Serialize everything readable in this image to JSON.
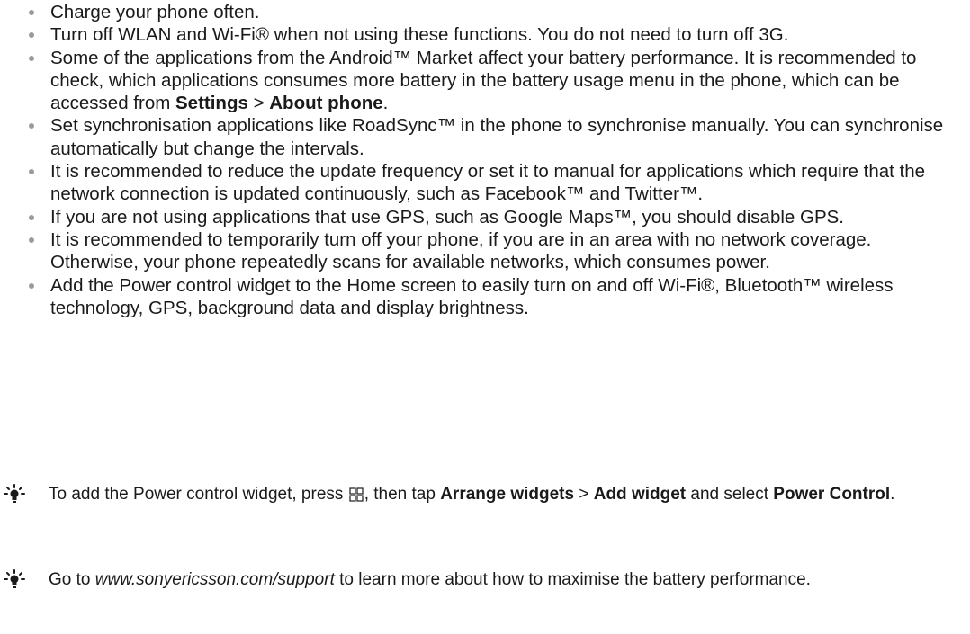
{
  "bullets": [
    {
      "text": "Charge your phone often."
    },
    {
      "text": "Turn off WLAN and Wi-Fi® when not using these functions. You do not need to turn off 3G."
    },
    {
      "pre": "Some of the applications from the Android™ Market affect your battery performance. It is recommended to check, which applications consumes more battery in the battery usage menu in the phone, which can be accessed from ",
      "b1": "Settings",
      "sep": " > ",
      "b2": "About phone",
      "post": "."
    },
    {
      "text": "Set synchronisation applications like RoadSync™ in the phone to synchronise manually. You can synchronise automatically but change the intervals."
    },
    {
      "text": "It is recommended to reduce the update frequency or set it to manual for applications which require that the network connection is updated continuously, such as Facebook™ and Twitter™."
    },
    {
      "text": "If you are not using applications that use GPS, such as Google Maps™, you should disable GPS."
    },
    {
      "text": "It is recommended to temporarily turn off your phone, if you are in an area with no network coverage. Otherwise, your phone repeatedly scans for available networks, which consumes power."
    },
    {
      "text": "Add the Power control widget to the Home screen to easily turn on and off Wi-Fi®, Bluetooth™ wireless technology, GPS, background data and display brightness."
    }
  ],
  "tip1": {
    "pre": "To add the Power control widget, press ",
    "mid": ", then tap ",
    "b1": "Arrange widgets",
    "sep": " > ",
    "b2": "Add widget",
    "and": " and select ",
    "b3": "Power Control",
    "post": ".",
    "icon": "tip-lightbulb-icon",
    "menu_icon": "menu-key-icon"
  },
  "tip2": {
    "pre": "Go to ",
    "link": "www.sonyericsson.com/support",
    "post": " to learn more about how to maximise the battery performance.",
    "icon": "tip-lightbulb-icon"
  },
  "colors": {
    "text": "#1a1a1a",
    "bullet": "#9a9a9a"
  }
}
